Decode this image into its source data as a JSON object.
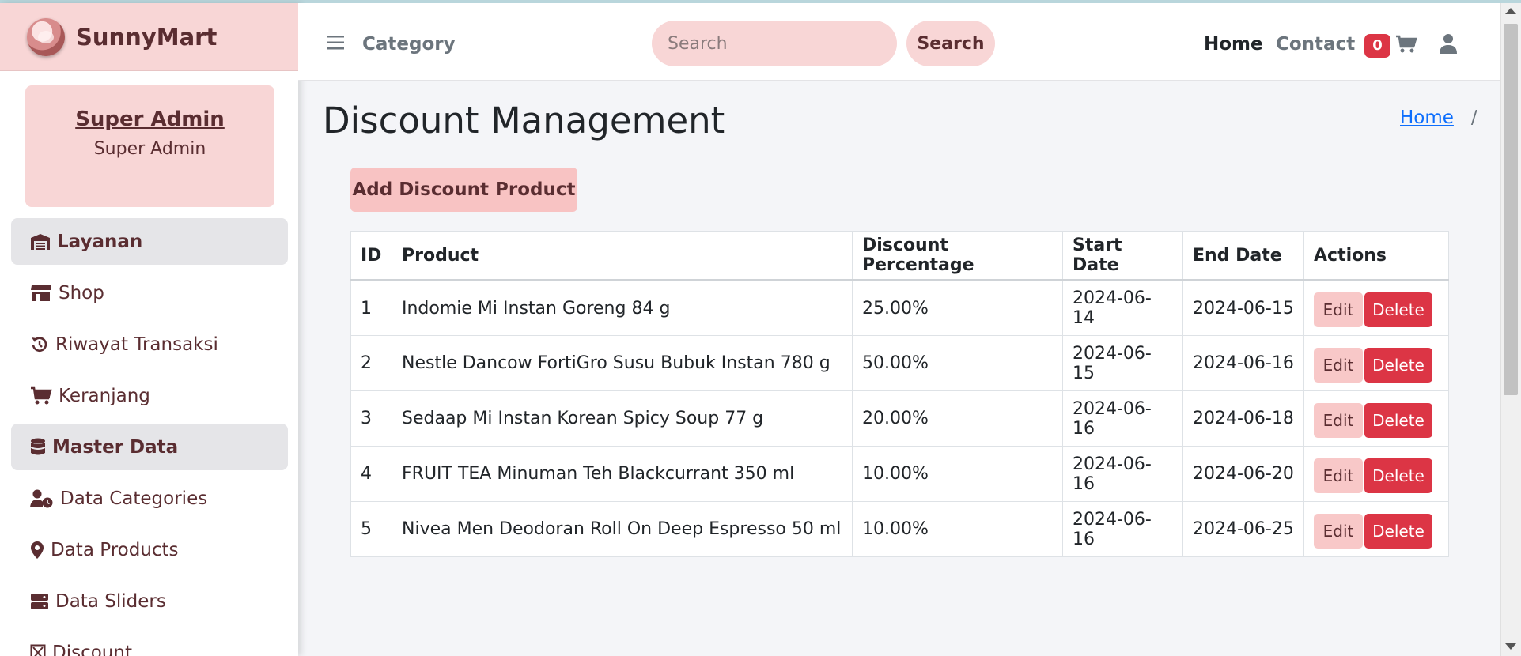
{
  "brand": {
    "name": "SunnyMart"
  },
  "user": {
    "name": "Super Admin",
    "role": "Super Admin"
  },
  "sidebar": {
    "items": [
      {
        "label": "Layanan",
        "icon": "warehouse-icon",
        "type": "header"
      },
      {
        "label": "Shop",
        "icon": "store-icon",
        "type": "link"
      },
      {
        "label": "Riwayat Transaksi",
        "icon": "history-icon",
        "type": "link"
      },
      {
        "label": "Keranjang",
        "icon": "cart-icon",
        "type": "link"
      },
      {
        "label": "Master Data",
        "icon": "database-icon",
        "type": "header"
      },
      {
        "label": "Data Categories",
        "icon": "user-clock-icon",
        "type": "link"
      },
      {
        "label": "Data Products",
        "icon": "map-pin-icon",
        "type": "link"
      },
      {
        "label": "Data Sliders",
        "icon": "server-icon",
        "type": "link"
      },
      {
        "label": "Discount",
        "icon": "percent-box-icon",
        "type": "link"
      }
    ]
  },
  "topbar": {
    "category_label": "Category",
    "search_placeholder": "Search",
    "search_button": "Search",
    "home_link": "Home",
    "contact_link": "Contact",
    "cart_count": "0"
  },
  "page": {
    "title": "Discount Management",
    "breadcrumb_home": "Home",
    "breadcrumb_sep": "/",
    "add_button": "Add Discount Product"
  },
  "table": {
    "headers": [
      "ID",
      "Product",
      "Discount Percentage",
      "Start Date",
      "End Date",
      "Actions"
    ],
    "rows": [
      {
        "id": "1",
        "product": "Indomie Mi Instan Goreng 84 g",
        "discount": "25.00%",
        "start": "2024-06-14",
        "end": "2024-06-15"
      },
      {
        "id": "2",
        "product": "Nestle Dancow FortiGro Susu Bubuk Instan 780 g",
        "discount": "50.00%",
        "start": "2024-06-15",
        "end": "2024-06-16"
      },
      {
        "id": "3",
        "product": "Sedaap Mi Instan Korean Spicy Soup 77 g",
        "discount": "20.00%",
        "start": "2024-06-16",
        "end": "2024-06-18"
      },
      {
        "id": "4",
        "product": "FRUIT TEA Minuman Teh Blackcurrant 350 ml",
        "discount": "10.00%",
        "start": "2024-06-16",
        "end": "2024-06-20"
      },
      {
        "id": "5",
        "product": "Nivea Men Deodoran Roll On Deep Espresso 50 ml",
        "discount": "10.00%",
        "start": "2024-06-16",
        "end": "2024-06-25"
      }
    ],
    "edit_label": "Edit",
    "delete_label": "Delete"
  },
  "colors": {
    "brand_pink": "#f8d6d6",
    "brand_text": "#5a2d31",
    "danger": "#dc3545",
    "link": "#0d6efd"
  }
}
